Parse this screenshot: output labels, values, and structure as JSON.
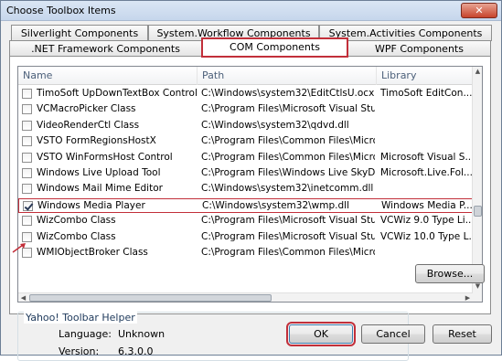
{
  "window": {
    "title": "Choose Toolbox Items",
    "close_label": "✕"
  },
  "tabs_top": [
    {
      "label": "Silverlight Components"
    },
    {
      "label": "System.Workflow Components"
    },
    {
      "label": "System.Activities Components"
    }
  ],
  "tabs_bottom": [
    {
      "label": ".NET Framework Components"
    },
    {
      "label": "COM Components",
      "active": true
    },
    {
      "label": "WPF Components"
    }
  ],
  "list": {
    "headers": [
      "Name",
      "Path",
      "Library"
    ],
    "rows": [
      {
        "checked": false,
        "name": "TimoSoft UpDownTextBox Control 1.6 ...",
        "path": "C:\\Windows\\system32\\EditCtlsU.ocx",
        "library": "TimoSoft EditCon..."
      },
      {
        "checked": false,
        "name": "VCMacroPicker Class",
        "path": "C:\\Program Files\\Microsoft Visual Studio...",
        "library": ""
      },
      {
        "checked": false,
        "name": "VideoRenderCtl Class",
        "path": "C:\\Windows\\system32\\qdvd.dll",
        "library": ""
      },
      {
        "checked": false,
        "name": "VSTO FormRegionsHostX",
        "path": "C:\\Program Files\\Common Files\\Micros...",
        "library": ""
      },
      {
        "checked": false,
        "name": "VSTO WinFormsHost Control",
        "path": "C:\\Program Files\\Common Files\\Micros...",
        "library": "Microsoft Visual S..."
      },
      {
        "checked": false,
        "name": "Windows Live Upload Tool",
        "path": "C:\\Program Files\\Windows Live SkyDrive...",
        "library": "Microsoft.Live.Fol..."
      },
      {
        "checked": false,
        "name": "Windows Mail Mime Editor",
        "path": "C:\\Windows\\system32\\inetcomm.dll",
        "library": ""
      },
      {
        "checked": true,
        "name": "Windows Media Player",
        "path": "C:\\Windows\\system32\\wmp.dll",
        "library": "Windows Media P...",
        "selected": true
      },
      {
        "checked": false,
        "name": "WizCombo Class",
        "path": "C:\\Program Files\\Microsoft Visual Studio...",
        "library": "VCWiz 9.0 Type Li..."
      },
      {
        "checked": false,
        "name": "WizCombo Class",
        "path": "C:\\Program Files\\Microsoft Visual Studio...",
        "library": "VCWiz 10.0 Type L..."
      },
      {
        "checked": false,
        "name": "WMIObjectBroker Class",
        "path": "C:\\Program Files\\Common Files\\Micros...",
        "library": ""
      }
    ]
  },
  "details": {
    "group_title": "Yahoo! Toolbar Helper",
    "language_label": "Language:",
    "language_value": "Unknown",
    "version_label": "Version:",
    "version_value": "6.3.0.0"
  },
  "buttons": {
    "browse": "Browse...",
    "ok": "OK",
    "cancel": "Cancel",
    "reset": "Reset"
  },
  "colors": {
    "highlight": "#c22f3a"
  }
}
